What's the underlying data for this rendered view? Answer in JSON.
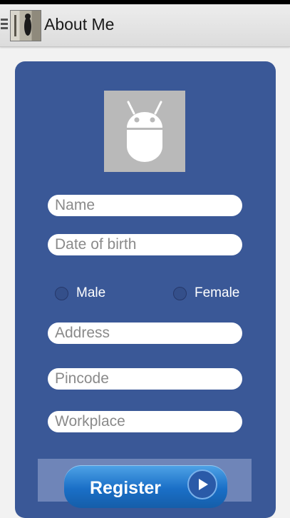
{
  "app": {
    "title": "About Me"
  },
  "icons": {
    "menu": "hamburger-menu-icon",
    "logo": "app-logo",
    "avatar": "android-robot-icon",
    "register": "play-arrow-icon"
  },
  "colors": {
    "card": "#3a5897",
    "actionbar": "#e6e6e6",
    "button": "#1a6fc7"
  },
  "form": {
    "name_placeholder": "Name",
    "dob_placeholder": "Date of birth",
    "gender": {
      "male": "Male",
      "female": "Female"
    },
    "address_placeholder": "Address",
    "pincode_placeholder": "Pincode",
    "workplace_placeholder": "Workplace",
    "register_label": "Register"
  }
}
